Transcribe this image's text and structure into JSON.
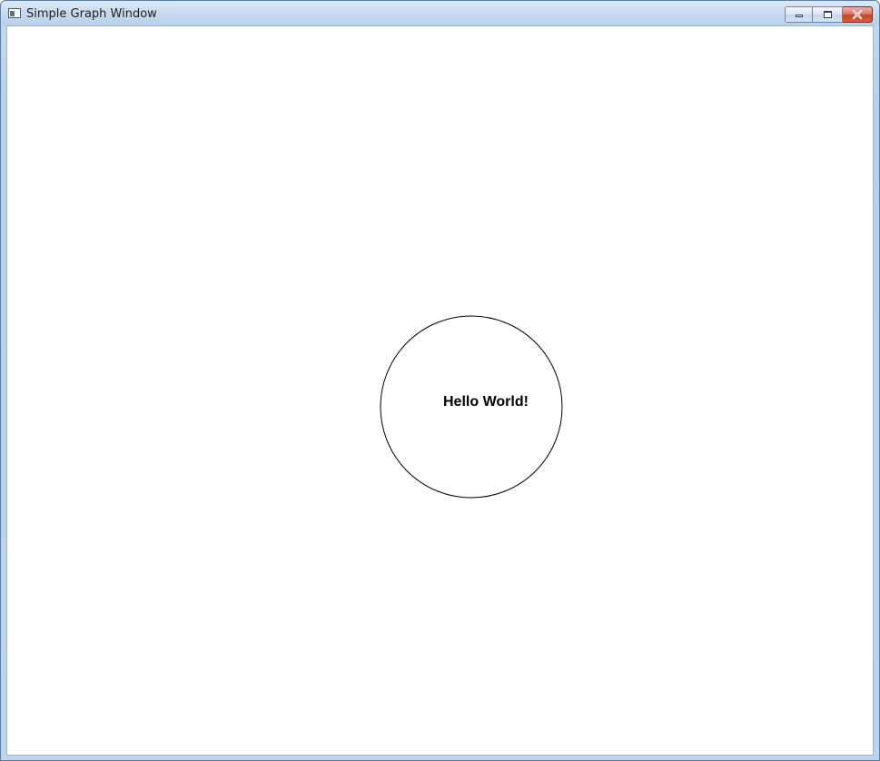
{
  "window": {
    "title": "Simple Graph Window",
    "controls": {
      "minimize_icon": "minimize-icon",
      "maximize_icon": "maximize-icon",
      "close_icon": "close-icon"
    },
    "colors": {
      "close_button": "#c7432b",
      "client_background": "#ffffff"
    }
  },
  "canvas": {
    "shape": "circle",
    "stroke_color": "#000000",
    "text": "Hello World!"
  }
}
